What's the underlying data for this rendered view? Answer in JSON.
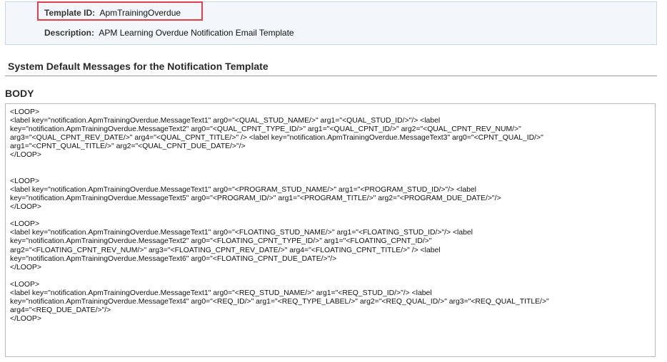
{
  "template": {
    "id_label": "Template ID:",
    "id_value": "ApmTrainingOverdue",
    "description_label": "Description:",
    "description_value": "APM Learning Overdue Notification Email Template"
  },
  "section": {
    "title": "System Default Messages for the Notification Template",
    "body_heading": "BODY"
  },
  "body": {
    "text": "<LOOP>\n<label key=\"notification.ApmTrainingOverdue.MessageText1\" arg0=\"<QUAL_STUD_NAME/>\" arg1=\"<QUAL_STUD_ID/>\"/> <label\nkey=\"notification.ApmTrainingOverdue.MessageText2\" arg0=\"<QUAL_CPNT_TYPE_ID/>\" arg1=\"<QUAL_CPNT_ID/>\" arg2=\"<QUAL_CPNT_REV_NUM/>\"\narg3=\"<QUAL_CPNT_REV_DATE/>\" arg4=\"<QUAL_CPNT_TITLE/>\" /> <label key=\"notification.ApmTrainingOverdue.MessageText3\" arg0=\"<CPNT_QUAL_ID/>\"\narg1=\"<CPNT_QUAL_TITLE/>\" arg2=\"<QUAL_CPNT_DUE_DATE/>\"/>\n</LOOP>\n\n\n<LOOP>\n<label key=\"notification.ApmTrainingOverdue.MessageText1\" arg0=\"<PROGRAM_STUD_NAME/>\" arg1=\"<PROGRAM_STUD_ID/>\"/> <label\nkey=\"notification.ApmTrainingOverdue.MessageText5\" arg0=\"<PROGRAM_ID/>\" arg1=\"<PROGRAM_TITLE/>\" arg2=\"<PROGRAM_DUE_DATE/>\"/>\n</LOOP>\n\n<LOOP>\n<label key=\"notification.ApmTrainingOverdue.MessageText1\" arg0=\"<FLOATING_STUD_NAME/>\" arg1=\"<FLOATING_STUD_ID/>\"/> <label\nkey=\"notification.ApmTrainingOverdue.MessageText2\" arg0=\"<FLOATING_CPNT_TYPE_ID/>\" arg1=\"<FLOATING_CPNT_ID/>\"\narg2=\"<FLOATING_CPNT_REV_NUM/>\" arg3=\"<FLOATING_CPNT_REV_DATE/>\" arg4=\"<FLOATING_CPNT_TITLE/>\" /> <label\nkey=\"notification.ApmTrainingOverdue.MessageText6\" arg0=\"<FLOATING_CPNT_DUE_DATE/>\"/>\n</LOOP>\n\n<LOOP>\n<label key=\"notification.ApmTrainingOverdue.MessageText1\" arg0=\"<REQ_STUD_NAME/>\" arg1=\"<REQ_STUD_ID/>\"/> <label\nkey=\"notification.ApmTrainingOverdue.MessageText4\" arg0=\"<REQ_ID/>\" arg1=\"<REQ_TYPE_LABEL/>\" arg2=\"<REQ_QUAL_ID/>\" arg3=\"<REQ_QUAL_TITLE/>\"\narg4=\"<REQ_DUE_DATE/>\"/>\n</LOOP>"
  },
  "colors": {
    "highlight_border": "#e0404a",
    "panel_background": "#f3f7fb"
  }
}
